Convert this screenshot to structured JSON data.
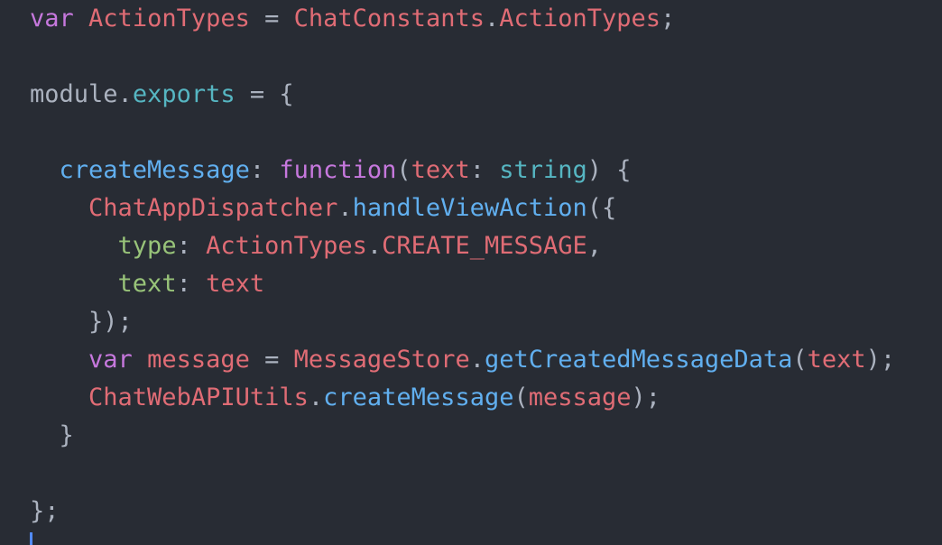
{
  "editor": {
    "lines": [
      [
        {
          "t": "var",
          "c": "kw"
        },
        {
          "t": " ",
          "c": "plain"
        },
        {
          "t": "ActionTypes",
          "c": "red"
        },
        {
          "t": " = ",
          "c": "plain"
        },
        {
          "t": "ChatConstants",
          "c": "red"
        },
        {
          "t": ".",
          "c": "plain"
        },
        {
          "t": "ActionTypes",
          "c": "red"
        },
        {
          "t": ";",
          "c": "plain"
        }
      ],
      [],
      [
        {
          "t": "module",
          "c": "plain"
        },
        {
          "t": ".",
          "c": "plain"
        },
        {
          "t": "exports",
          "c": "cyan"
        },
        {
          "t": " = {",
          "c": "plain"
        }
      ],
      [],
      [
        {
          "t": "  ",
          "c": "plain"
        },
        {
          "t": "createMessage",
          "c": "fn"
        },
        {
          "t": ": ",
          "c": "plain"
        },
        {
          "t": "function",
          "c": "kw"
        },
        {
          "t": "(",
          "c": "plain"
        },
        {
          "t": "text",
          "c": "red"
        },
        {
          "t": ": ",
          "c": "plain"
        },
        {
          "t": "string",
          "c": "cyan"
        },
        {
          "t": ") {",
          "c": "plain"
        }
      ],
      [
        {
          "t": "    ",
          "c": "plain"
        },
        {
          "t": "ChatAppDispatcher",
          "c": "red"
        },
        {
          "t": ".",
          "c": "plain"
        },
        {
          "t": "handleViewAction",
          "c": "fn"
        },
        {
          "t": "({",
          "c": "plain"
        }
      ],
      [
        {
          "t": "      ",
          "c": "plain"
        },
        {
          "t": "type",
          "c": "prop"
        },
        {
          "t": ": ",
          "c": "plain"
        },
        {
          "t": "ActionTypes",
          "c": "red"
        },
        {
          "t": ".",
          "c": "plain"
        },
        {
          "t": "CREATE_MESSAGE",
          "c": "red"
        },
        {
          "t": ",",
          "c": "plain"
        }
      ],
      [
        {
          "t": "      ",
          "c": "plain"
        },
        {
          "t": "text",
          "c": "prop"
        },
        {
          "t": ": ",
          "c": "plain"
        },
        {
          "t": "text",
          "c": "red"
        }
      ],
      [
        {
          "t": "    });",
          "c": "plain"
        }
      ],
      [
        {
          "t": "    ",
          "c": "plain"
        },
        {
          "t": "var",
          "c": "kw"
        },
        {
          "t": " ",
          "c": "plain"
        },
        {
          "t": "message",
          "c": "red"
        },
        {
          "t": " = ",
          "c": "plain"
        },
        {
          "t": "MessageStore",
          "c": "red"
        },
        {
          "t": ".",
          "c": "plain"
        },
        {
          "t": "getCreatedMessageData",
          "c": "fn"
        },
        {
          "t": "(",
          "c": "plain"
        },
        {
          "t": "text",
          "c": "red"
        },
        {
          "t": ");",
          "c": "plain"
        }
      ],
      [
        {
          "t": "    ",
          "c": "plain"
        },
        {
          "t": "ChatWebAPIUtils",
          "c": "red"
        },
        {
          "t": ".",
          "c": "plain"
        },
        {
          "t": "createMessage",
          "c": "fn"
        },
        {
          "t": "(",
          "c": "plain"
        },
        {
          "t": "message",
          "c": "red"
        },
        {
          "t": ");",
          "c": "plain"
        }
      ],
      [
        {
          "t": "  }",
          "c": "plain"
        }
      ],
      [],
      [
        {
          "t": "};",
          "c": "plain"
        }
      ]
    ]
  },
  "colors": {
    "background": "#282c34",
    "keyword": "#c678dd",
    "variable": "#e06c75",
    "function": "#61afef",
    "property": "#98c379",
    "support": "#56b6c2",
    "text": "#abb2bf",
    "cursor": "#528bff"
  }
}
